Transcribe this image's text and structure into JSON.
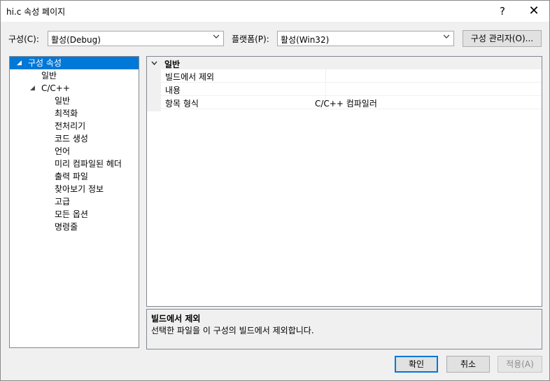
{
  "window": {
    "title": "hi.c 속성 페이지",
    "help": "?",
    "close": "✕"
  },
  "toolbar": {
    "config_label": "구성(C):",
    "config_value": "활성(Debug)",
    "platform_label": "플랫폼(P):",
    "platform_value": "활성(Win32)",
    "config_manager_button": "구성 관리자(O)..."
  },
  "tree": {
    "items": [
      {
        "label": "구성 속성",
        "level": 0,
        "expanded": true,
        "selected": true
      },
      {
        "label": "일반",
        "level": 1
      },
      {
        "label": "C/C++",
        "level": 1,
        "expanded": true
      },
      {
        "label": "일반",
        "level": 2
      },
      {
        "label": "최적화",
        "level": 2
      },
      {
        "label": "전처리기",
        "level": 2
      },
      {
        "label": "코드 생성",
        "level": 2
      },
      {
        "label": "언어",
        "level": 2
      },
      {
        "label": "미리 컴파일된 헤더",
        "level": 2
      },
      {
        "label": "출력 파일",
        "level": 2
      },
      {
        "label": "찾아보기 정보",
        "level": 2
      },
      {
        "label": "고급",
        "level": 2
      },
      {
        "label": "모든 옵션",
        "level": 2
      },
      {
        "label": "명령줄",
        "level": 2
      }
    ]
  },
  "grid": {
    "category": "일반",
    "properties": [
      {
        "name": "빌드에서 제외",
        "value": ""
      },
      {
        "name": "내용",
        "value": ""
      },
      {
        "name": "항목 형식",
        "value": "C/C++ 컴파일러"
      }
    ]
  },
  "description": {
    "title": "빌드에서 제외",
    "text": "선택한 파일을 이 구성의 빌드에서 제외합니다."
  },
  "buttons": {
    "ok": "확인",
    "cancel": "취소",
    "apply": "적용(A)"
  }
}
